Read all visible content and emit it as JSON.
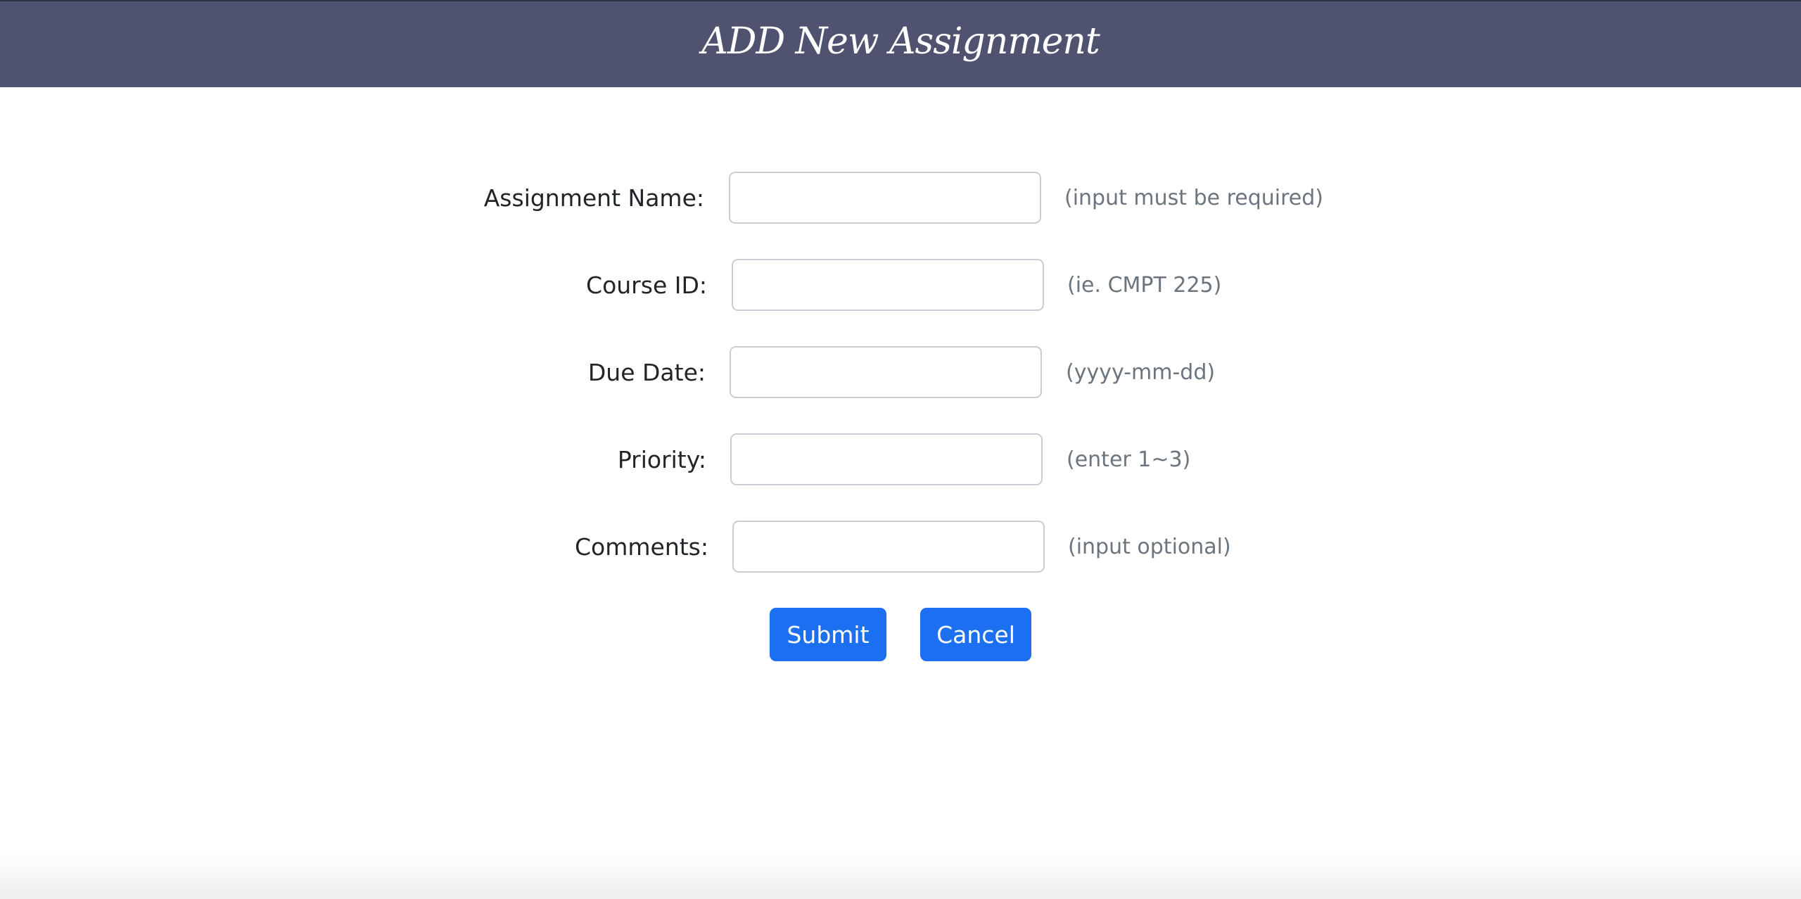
{
  "header": {
    "title": "ADD New Assignment"
  },
  "form": {
    "fields": [
      {
        "label": "Assignment Name:",
        "value": "",
        "hint": "(input must be required)"
      },
      {
        "label": "Course ID:",
        "value": "",
        "hint": "(ie. CMPT 225)"
      },
      {
        "label": "Due Date:",
        "value": "",
        "hint": "(yyyy-mm-dd)"
      },
      {
        "label": "Priority:",
        "value": "",
        "hint": "(enter 1~3)"
      },
      {
        "label": "Comments:",
        "value": "",
        "hint": "(input optional)"
      }
    ],
    "submit_label": "Submit",
    "cancel_label": "Cancel"
  },
  "colors": {
    "header_bg": "#4f536f",
    "button_bg": "#1d6ff2",
    "hint_text": "#6c757d"
  }
}
